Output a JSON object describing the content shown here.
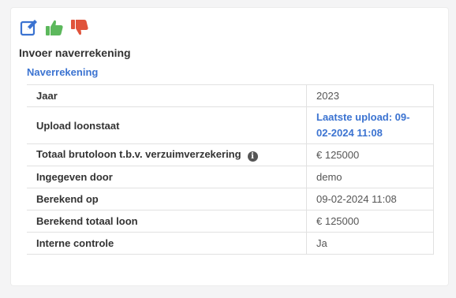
{
  "toolbar": {
    "icons": [
      "edit-icon",
      "thumbs-up-icon",
      "thumbs-down-icon"
    ],
    "colors": {
      "edit": "#3b73d1",
      "approve": "#5cb85c",
      "reject": "#e0533b"
    }
  },
  "page": {
    "title": "Invoer naverrekening",
    "section_link": "Naverrekening"
  },
  "rows": [
    {
      "label": "Jaar",
      "value": "2023"
    },
    {
      "label": "Upload loonstaat",
      "value": "Laatste upload: 09-02-2024 11:08"
    },
    {
      "label": "Totaal brutoloon t.b.v. verzuimverzekering",
      "value": "€ 125000",
      "info": "i"
    },
    {
      "label": "Ingegeven door",
      "value": "demo"
    },
    {
      "label": "Berekend op",
      "value": "09-02-2024 11:08"
    },
    {
      "label": "Berekend totaal loon",
      "value": "€ 125000"
    },
    {
      "label": "Interne controle",
      "value": "Ja"
    }
  ]
}
